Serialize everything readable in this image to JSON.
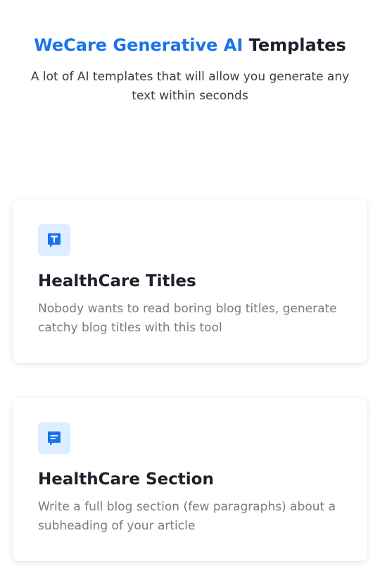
{
  "header": {
    "title_accent": "WeCare Generative AI",
    "title_rest": "Templates",
    "subtitle": "A lot of AI templates that will allow you generate any text within seconds"
  },
  "cards": [
    {
      "icon": "text-chat-icon",
      "title": "HealthCare Titles",
      "description": "Nobody wants to read boring blog titles, generate catchy blog titles with this tool"
    },
    {
      "icon": "message-lines-icon",
      "title": "HealthCare Section",
      "description": "Write a full blog section (few paragraphs) about a subheading of your article"
    }
  ],
  "colors": {
    "accent": "#1a73e8",
    "icon_bg": "#dceeff",
    "heading": "#1f1f2b",
    "muted": "#7a7a85"
  }
}
